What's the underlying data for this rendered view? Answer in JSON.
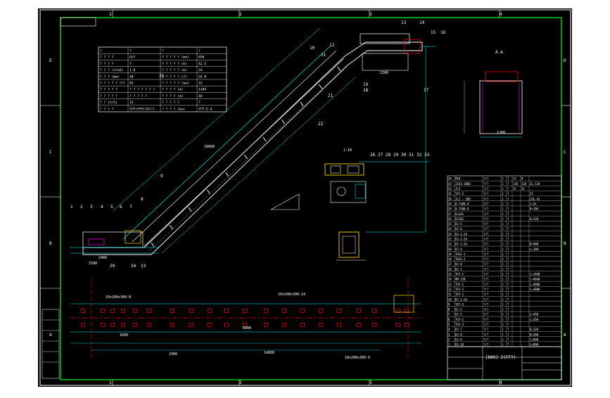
{
  "drawing": {
    "colors": {
      "background": "#000000",
      "outer_bg": "#ffffff",
      "frame": "#00ff00",
      "line_white": "#ffffff",
      "dim_cyan": "#00ffff",
      "accent_red": "#ff0000",
      "accent_yellow": "#ffd700",
      "accent_magenta": "#ff00ff",
      "label_green": "#00ff00"
    },
    "zone_columns_top": [
      "1",
      "2",
      "3",
      "4"
    ],
    "zone_columns_bottom": [
      "1",
      "2",
      "3",
      "4"
    ],
    "zone_rows_left": [
      "D",
      "C",
      "B",
      "A"
    ],
    "zone_rows_right": [
      "D",
      "C",
      "B",
      "A"
    ],
    "section_label": "A-A",
    "scale_label": "1:10",
    "title_block_name": "[B00] 2(FFY)",
    "main_view_callouts": [
      "1",
      "2",
      "3",
      "4",
      "5",
      "6",
      "7",
      "8",
      "9",
      "10",
      "11",
      "12",
      "13",
      "14",
      "15",
      "16",
      "17",
      "18",
      "19",
      "20",
      "21",
      "22",
      "23",
      "24",
      "25"
    ],
    "drive_callouts": [
      "26",
      "27",
      "28",
      "29",
      "30",
      "31",
      "32",
      "33"
    ],
    "dimension_labels": [
      "2480",
      "1580",
      "28000",
      "2300",
      "1200",
      "8900",
      "14800"
    ],
    "plan_view_labels": [
      "10x200x300-B",
      "10x200x300-24",
      "10x200x300-6",
      "1600",
      "2400"
    ],
    "spec_table_rows": [
      [
        "?",
        "?",
        "?",
        "?"
      ],
      [
        "? ? ? ?",
        "GLF",
        "? ? ? ? ? (mm)",
        "650"
      ],
      [
        "? ? ? ?",
        "?",
        "? ? ? ? ? (m)",
        "42.5"
      ],
      [
        "? ? ? (t/m3)",
        "1.8",
        "? ? ? ? ? (m)",
        "16"
      ],
      [
        "? ? ? (mm)",
        "30",
        "? ? ? ? ? (?)",
        "25.8"
      ],
      [
        "? ? ? ? ? (?)",
        "45",
        "? ? ? ? ? (kw)",
        "15"
      ],
      [
        "? ? ? ? ?",
        "? ? ? ? ? ? ?",
        "? ? ? ? (m)",
        "1184"
      ],
      [
        "? ? ? ? ?",
        "? ? ? ? ?",
        "? ? ? ? (m)",
        "40"
      ],
      [
        "? ? (t/h)",
        "15",
        "? ? ? ? ?",
        "?"
      ],
      [
        "? ? ? ?",
        "YCF(FFP)19(?)",
        "? ? ? ? (kw)",
        "YCF-E-4"
      ]
    ],
    "parts_list": [
      [
        "34",
        "M16",
        "?/?",
        "1",
        "?",
        "21",
        "8",
        ""
      ],
      [
        "33",
        "JZS1-1060",
        "?/?",
        "1",
        "?",
        "126",
        "126",
        "ZL-110"
      ],
      [
        "32",
        "JL5",
        "?/?",
        "1",
        "?",
        "31",
        "31",
        ""
      ],
      [
        "31",
        "YFF-5",
        "?/?",
        "1",
        "?",
        "",
        "",
        "15"
      ],
      [
        "30",
        "JL1 - 100",
        "?/?",
        "1",
        "?",
        "",
        "",
        "LOL-41"
      ],
      [
        "29",
        "B-7100-9",
        "?/?",
        "1",
        "?",
        "",
        "",
        "L=2k"
      ],
      [
        "28",
        "B-7100-8",
        "?/?",
        "1",
        "?",
        "",
        "",
        "R=100"
      ],
      [
        "27",
        "DJ101",
        "?/?",
        "1",
        "?",
        "",
        "",
        ""
      ],
      [
        "26",
        "DJ101",
        "?/?",
        "1",
        "?",
        "",
        "",
        "D=320"
      ],
      [
        "25",
        "DJ-5",
        "?/?",
        "1",
        "?",
        "",
        "",
        ""
      ],
      [
        "24",
        "DJ-6",
        "?/?",
        "1",
        "?",
        "",
        "",
        ""
      ],
      [
        "23",
        "DJ-1-2A",
        "?/?",
        "2",
        "?",
        "",
        "",
        ""
      ],
      [
        "22",
        "DJ-1-2A",
        "?/?",
        "2",
        "?",
        "",
        "",
        ""
      ],
      [
        "21",
        "DJ-1-2A",
        "?/?",
        "1",
        "?",
        "",
        "",
        "D=400"
      ],
      [
        "20",
        "DJ-4",
        "?/?",
        "1",
        "?",
        "",
        "",
        "L=100"
      ],
      [
        "19",
        "TGG1-1",
        "?/?",
        "1",
        "?",
        "",
        "",
        ""
      ],
      [
        "18",
        "TGG1-2",
        "?/?",
        "1",
        "?",
        "",
        "",
        ""
      ],
      [
        "17",
        "DJ-0",
        "?/?",
        "1",
        "?",
        "",
        "",
        ""
      ],
      [
        "16",
        "DJ-1",
        "?/?",
        "1",
        "?",
        "",
        "",
        ""
      ],
      [
        "15",
        "TGY-1",
        "?/?",
        "2",
        "?",
        "",
        "",
        "L=1840"
      ],
      [
        "14",
        "HM-150",
        "?/?",
        "1",
        "?",
        "",
        "",
        "L=4840"
      ],
      [
        "13",
        "TGY-1",
        "?/?",
        "1",
        "?",
        "",
        "",
        "L=4800"
      ],
      [
        "12",
        "TGY-1",
        "?/?",
        "2",
        "?",
        "",
        "",
        "L=4800"
      ],
      [
        "11",
        "TGY-1",
        "?/?",
        "1",
        "?",
        "",
        "",
        ""
      ],
      [
        "10",
        "DJ-1-2A",
        "?/?",
        "1",
        "?",
        "",
        "",
        ""
      ],
      [
        "9",
        "TGY-5",
        "?/?",
        "1",
        "?",
        "",
        "",
        ""
      ],
      [
        "8",
        "DJ-2",
        "?/?",
        "1",
        "?",
        "",
        "",
        ""
      ],
      [
        "7",
        "DJ-2",
        "?/?",
        "2",
        "?",
        "",
        "",
        "L=450"
      ],
      [
        "6",
        "TGY-1",
        "?/?",
        "1",
        "?",
        "",
        "",
        "L=450"
      ],
      [
        "5",
        "TGY-2",
        "?/?",
        "1",
        "?",
        "",
        "",
        ""
      ],
      [
        "4",
        "DJ-7",
        "?/?",
        "1",
        "?",
        "",
        "",
        "D=320"
      ],
      [
        "3",
        "DJ-8",
        "?/?",
        "1",
        "?",
        "",
        "",
        "D=300"
      ],
      [
        "2",
        "DJ-9",
        "?/?",
        "1",
        "?",
        "",
        "",
        "L=800"
      ],
      [
        "1",
        "DJ-10",
        "?/?",
        "1",
        "?",
        "",
        "",
        "L=800"
      ]
    ]
  }
}
